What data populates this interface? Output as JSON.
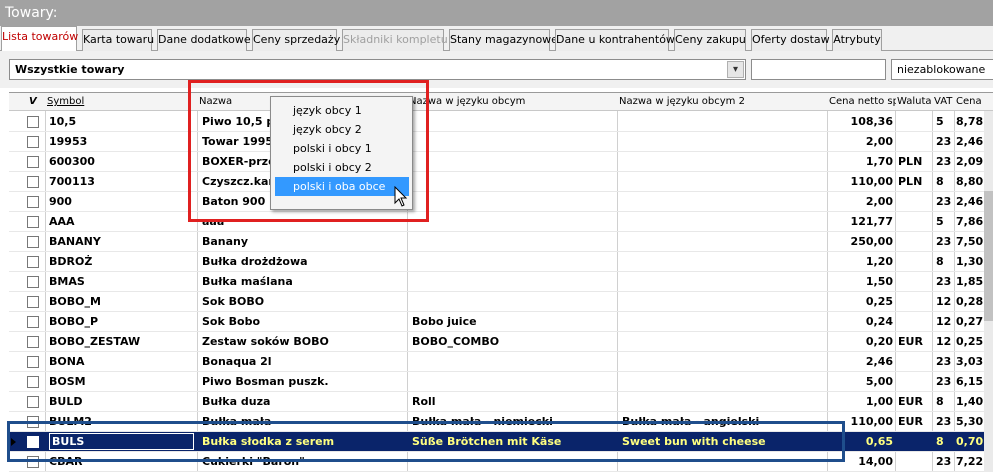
{
  "window": {
    "title": "Towary:"
  },
  "tabs": [
    {
      "label": "Lista towarów",
      "active": true
    },
    {
      "label": "Karta towaru"
    },
    {
      "label": "Dane dodatkowe"
    },
    {
      "label": "Ceny sprzedaży"
    },
    {
      "label": "Składniki kompletu",
      "disabled": true
    },
    {
      "label": "Stany magazynowe"
    },
    {
      "label": "Dane u kontrahentów"
    },
    {
      "label": "Ceny zakupu"
    },
    {
      "label": "Oferty dostaw"
    },
    {
      "label": "Atrybuty"
    }
  ],
  "filters": {
    "group_value": "Wszystkie towary",
    "search_value": "",
    "status_value": "niezablokowane"
  },
  "columns": {
    "check": "V",
    "symbol": "Symbol",
    "name": "Nazwa",
    "foreign_name": "Nazwa w języku obcym",
    "foreign_name2": "Nazwa w języku obcym 2",
    "price": "Cena netto sp",
    "currency": "Waluta",
    "vat": "VAT",
    "gross": "Cena"
  },
  "rows": [
    {
      "symbol": "10,5",
      "name": "Piwo 10,5 p",
      "fn": "",
      "fn2": "",
      "price": "108,36",
      "cur": "",
      "vat": "5",
      "gross": "8,78"
    },
    {
      "symbol": "19953",
      "name": "Towar 1995",
      "fn": "",
      "fn2": "",
      "price": "2,00",
      "cur": "",
      "vat": "23",
      "gross": "2,46"
    },
    {
      "symbol": "600300",
      "name": "BOXER-prze",
      "fn": "",
      "fn2": "",
      "price": "1,70",
      "cur": "PLN",
      "vat": "23",
      "gross": "2,09"
    },
    {
      "symbol": "700113",
      "name": "Czyszcz.kar",
      "fn": "",
      "fn2": "",
      "price": "110,00",
      "cur": "PLN",
      "vat": "8",
      "gross": "8,80"
    },
    {
      "symbol": "900",
      "name": "Baton 900",
      "fn": "",
      "fn2": "",
      "price": "2,00",
      "cur": "",
      "vat": "23",
      "gross": "2,46"
    },
    {
      "symbol": "AAA",
      "name": "aaa",
      "fn": "",
      "fn2": "",
      "price": "121,77",
      "cur": "",
      "vat": "5",
      "gross": "7,86"
    },
    {
      "symbol": "BANANY",
      "name": "Banany",
      "fn": "",
      "fn2": "",
      "price": "250,00",
      "cur": "",
      "vat": "23",
      "gross": "7,50"
    },
    {
      "symbol": "BDROŻ",
      "name": "Bułka drożdżowa",
      "fn": "",
      "fn2": "",
      "price": "1,20",
      "cur": "",
      "vat": "8",
      "gross": "1,30"
    },
    {
      "symbol": "BMAS",
      "name": "Bułka maślana",
      "fn": "",
      "fn2": "",
      "price": "1,50",
      "cur": "",
      "vat": "23",
      "gross": "1,85"
    },
    {
      "symbol": "BOBO_M",
      "name": "Sok BOBO",
      "fn": "",
      "fn2": "",
      "price": "0,25",
      "cur": "",
      "vat": "12",
      "gross": "0,28"
    },
    {
      "symbol": "BOBO_P",
      "name": "Sok Bobo",
      "fn": "Bobo juice",
      "fn2": "",
      "price": "0,24",
      "cur": "",
      "vat": "12",
      "gross": "0,27"
    },
    {
      "symbol": "BOBO_ZESTAW",
      "name": "Zestaw soków BOBO",
      "fn": "BOBO_COMBO",
      "fn2": "",
      "price": "0,20",
      "cur": "EUR",
      "vat": "12",
      "gross": "0,25"
    },
    {
      "symbol": "BONA",
      "name": "Bonaqua 2l",
      "fn": "",
      "fn2": "",
      "price": "2,46",
      "cur": "",
      "vat": "23",
      "gross": "3,03"
    },
    {
      "symbol": "BOSM",
      "name": "Piwo Bosman puszk.",
      "fn": "",
      "fn2": "",
      "price": "5,00",
      "cur": "",
      "vat": "23",
      "gross": "6,15"
    },
    {
      "symbol": "BULD",
      "name": "Bułka duza",
      "fn": "Roll",
      "fn2": "",
      "price": "1,00",
      "cur": "EUR",
      "vat": "8",
      "gross": "1,40"
    },
    {
      "symbol": "BULM2",
      "name": "Bułka mała",
      "fn": "Bułka mała - niemiecki",
      "fn2": "Bułka mała - angielski",
      "price": "110,00",
      "cur": "EUR",
      "vat": "23",
      "gross": "5,30"
    },
    {
      "symbol": "BULS",
      "name": "Bułka słodka z serem",
      "fn": "Süße Brötchen mit Käse",
      "fn2": "Sweet bun with cheese",
      "price": "0,65",
      "cur": "",
      "vat": "8",
      "gross": "0,70",
      "selected": true
    },
    {
      "symbol": "CBAR",
      "name": "Cukierki \"Baron\"",
      "fn": "",
      "fn2": "",
      "price": "14,00",
      "cur": "",
      "vat": "23",
      "gross": "7,22"
    }
  ],
  "language_menu": {
    "items": [
      "język obcy 1",
      "język obcy 2",
      "polski i obcy 1",
      "polski i obcy 2",
      "polski i oba obce"
    ],
    "highlighted": "polski i oba obce"
  },
  "colors": {
    "selection_bg": "#0a246a",
    "selection_text": "#ffff80",
    "menu_highlight": "#3399ff",
    "red_annotation": "#e02020",
    "blue_annotation": "#1f4e8c"
  }
}
